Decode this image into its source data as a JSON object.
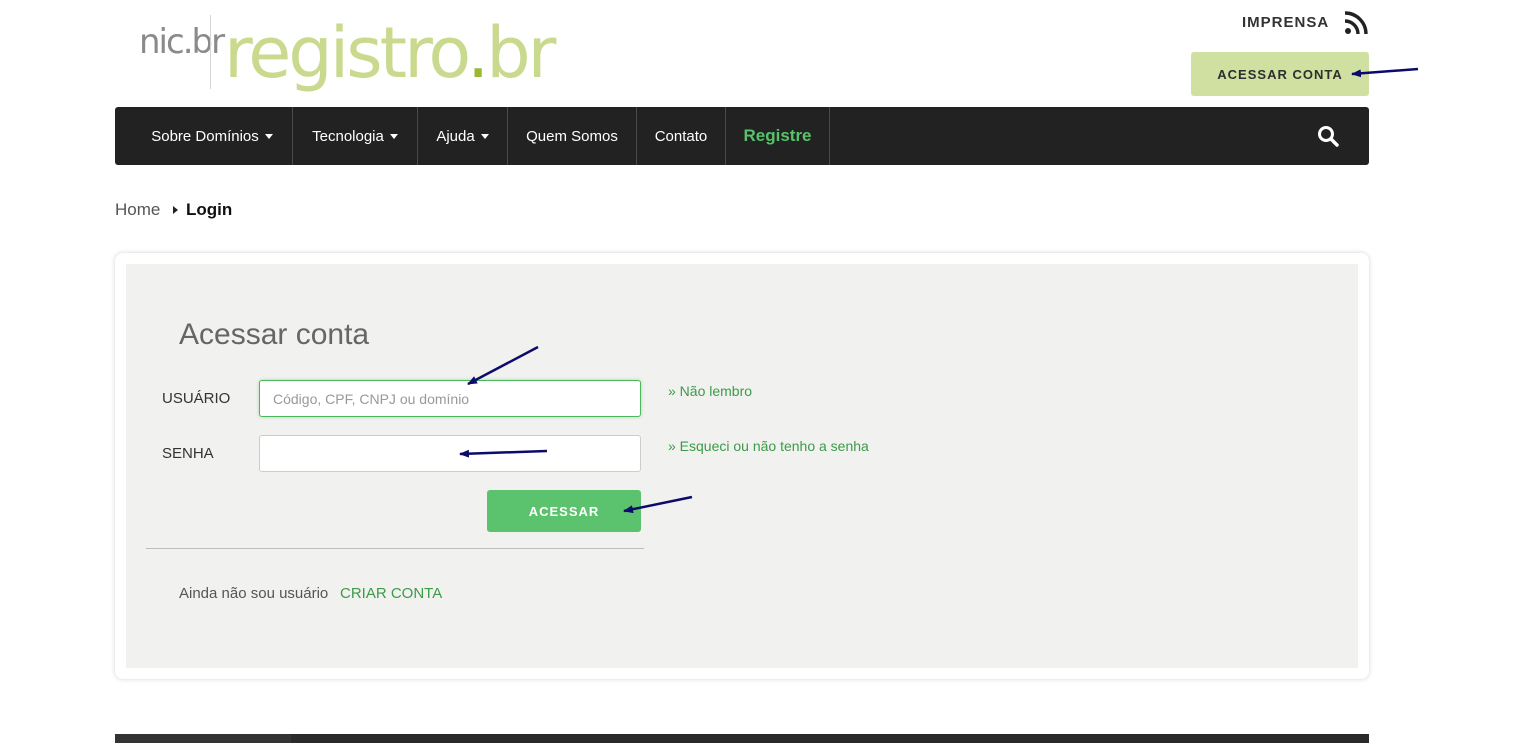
{
  "logo": {
    "nic": "nic.br",
    "brand_main": "registro",
    "brand_dot": ".",
    "brand_tld": "br"
  },
  "header": {
    "imprensa_label": "IMPRENSA",
    "rss_icon": "rss-icon",
    "account_button": "ACESSAR CONTA"
  },
  "nav": {
    "items": [
      {
        "label": "Sobre Domínios",
        "dropdown": true
      },
      {
        "label": "Tecnologia",
        "dropdown": true
      },
      {
        "label": "Ajuda",
        "dropdown": true
      },
      {
        "label": "Quem Somos",
        "dropdown": false
      },
      {
        "label": "Contato",
        "dropdown": false
      },
      {
        "label": "Registre",
        "dropdown": false
      }
    ],
    "search_icon": "search-icon"
  },
  "breadcrumb": {
    "home": "Home",
    "current": "Login"
  },
  "login": {
    "title": "Acessar conta",
    "user_label": "USUÁRIO",
    "user_placeholder": "Código, CPF, CNPJ ou domínio",
    "user_value": "",
    "pass_label": "SENHA",
    "pass_value": "",
    "forgot_user_link": "» Não lembro",
    "forgot_pass_link": "» Esqueci ou não tenho a senha",
    "submit_label": "ACESSAR",
    "signup_text": "Ainda não sou usuário",
    "signup_link": "CRIAR CONTA"
  },
  "colors": {
    "accent_green": "#5bc26d",
    "link_green": "#3d9b48",
    "account_button_bg": "#cfe0a0",
    "nav_bg": "#222222",
    "panel_bg": "#f1f1ef",
    "arrow": "#0b0b6b"
  }
}
